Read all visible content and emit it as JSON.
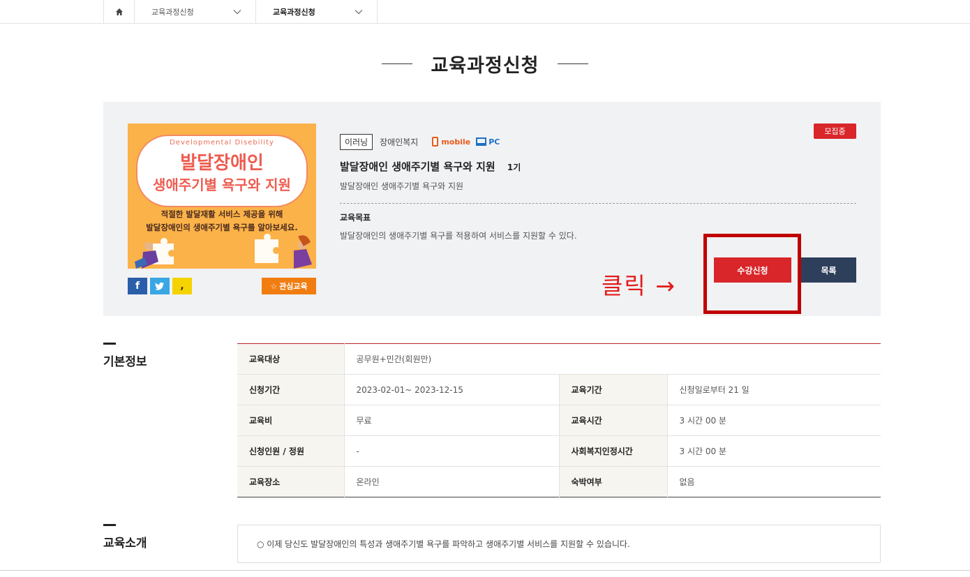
{
  "nav": {
    "home_icon": "home-icon",
    "crumb1": "교육과정신청",
    "crumb2": "교육과정신청"
  },
  "page_title": "교육과정신청",
  "course": {
    "thumb": {
      "english": "Developmental Disebility",
      "title1": "발달장애인",
      "title2": "생애주기별 욕구와 지원",
      "desc1": "적절한 발달재활 서비스 제공을 위해",
      "desc2": "발달장애인의 생애주기별 욕구를 알아보세요."
    },
    "tag": "이러닝",
    "category": "장애인복지",
    "mobile_label": "mobile",
    "pc_label": "PC",
    "status": "모집중",
    "title": "발달장애인 생애주기별 욕구와 지원",
    "generation": "1기",
    "subtitle": "발달장애인 생애주기별 욕구와 지원",
    "goal_label": "교육목표",
    "goal_text": "발달장애인의 생애주기별 욕구를 적용하여 서비스를 지원할 수 있다.",
    "social": {
      "fb": "f",
      "tw": "t",
      "ks": ","
    },
    "fav_label": "관심교육",
    "apply_label": "수강신청",
    "list_label": "목록",
    "annotation": "클릭 →",
    "colors": {
      "accent": "#d8262a",
      "navy": "#2e3f5b",
      "orange": "#f17d11"
    }
  },
  "basic": {
    "title": "기본정보",
    "rows": [
      {
        "l1": "교육대상",
        "v1": "공무원+민간(회원만)"
      },
      {
        "l1": "신청기간",
        "v1": "2023-02-01~ 2023-12-15",
        "l2": "교육기간",
        "v2": "신청일로부터 21 일"
      },
      {
        "l1": "교육비",
        "v1": "무료",
        "l2": "교육시간",
        "v2": "3 시간 00 분"
      },
      {
        "l1": "신청인원 / 정원",
        "v1": "-",
        "l2": "사회복지인정시간",
        "v2": "3 시간 00 분"
      },
      {
        "l1": "교육장소",
        "v1": "온라인",
        "l2": "숙박여부",
        "v2": "없음"
      }
    ]
  },
  "intro": {
    "title": "교육소개",
    "text": "○ 이제 당신도 발달장애인의 특성과 생애주기별 욕구를 파악하고 생애주기별 서비스를 지원할 수 있습니다."
  }
}
